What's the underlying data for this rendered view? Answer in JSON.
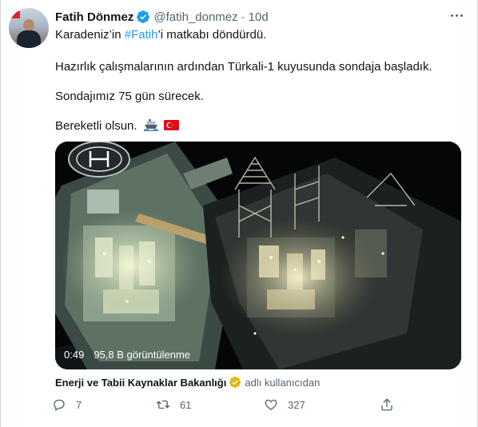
{
  "tweet": {
    "author_name": "Fatih Dönmez",
    "author_handle": "@fatih_donmez",
    "separator": "·",
    "timestamp": "10d",
    "line1_prefix": "Karadeniz’in ",
    "line1_hashtag": "#Fatih",
    "line1_suffix": "’i matkabı döndürdü.",
    "line2": "Hazırlık çalışmalarının ardından Türkali-1 kuyusunda sondaja başladık.",
    "line3": "Sondajımız 75 gün sürecek.",
    "line4": "Bereketli olsun.",
    "emojis": [
      "ship",
      "turkey-flag"
    ]
  },
  "media": {
    "duration": "0:49",
    "views": "95,8 B görüntülenme"
  },
  "attribution": {
    "org": "Enerji ve Tabii Kaynaklar Bakanlığı",
    "via": "adlı kullanıcıdan"
  },
  "actions": {
    "replies": "7",
    "retweets": "61",
    "likes": "327"
  },
  "colors": {
    "accent": "#1d9bf0",
    "text": "#0f1419",
    "muted": "#536471",
    "gold_badge": "#e2b719"
  }
}
